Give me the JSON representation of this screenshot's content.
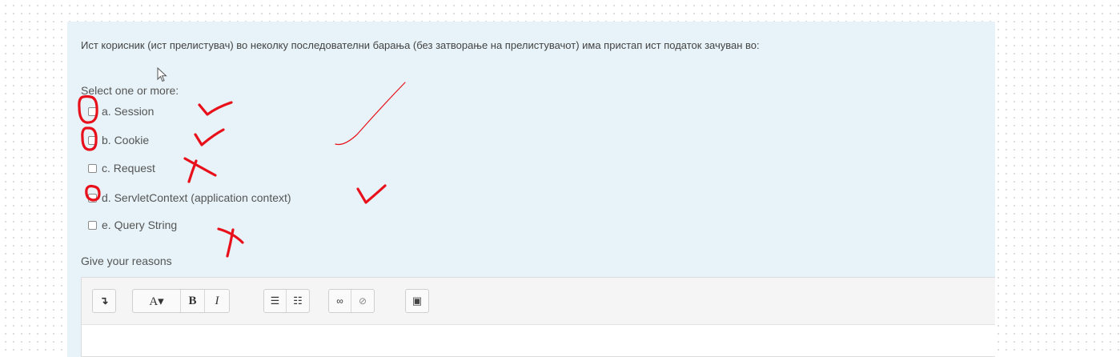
{
  "question": {
    "text": "Ист корисник (ист прелистувач) во неколку последователни барања (без затворање на прелистувачот) има пристап ист податок зачуван во:",
    "prompt": "Select one or more:",
    "answers": [
      {
        "label": "a. Session",
        "checked": false
      },
      {
        "label": "b. Cookie",
        "checked": false
      },
      {
        "label": "c. Request",
        "checked": false
      },
      {
        "label": "d. ServletContext (application context)",
        "checked": false
      },
      {
        "label": "e. Query String",
        "checked": false
      }
    ],
    "reasons_label": "Give your reasons"
  },
  "toolbar": {
    "buttons": [
      {
        "icon": "collapse-toolbar-icon",
        "glyph": "↴"
      },
      {
        "icon": "font-size-icon",
        "glyph": "A▾"
      },
      {
        "icon": "bold-icon",
        "glyph": "B"
      },
      {
        "icon": "italic-icon",
        "glyph": "I"
      },
      {
        "icon": "unordered-list-icon",
        "glyph": "☰"
      },
      {
        "icon": "ordered-list-icon",
        "glyph": "☷"
      },
      {
        "icon": "link-icon",
        "glyph": "∞"
      },
      {
        "icon": "unlink-icon",
        "glyph": "⊘"
      },
      {
        "icon": "image-icon",
        "glyph": "▣"
      }
    ]
  },
  "annotation_colors": {
    "marker": "#e8101a"
  }
}
